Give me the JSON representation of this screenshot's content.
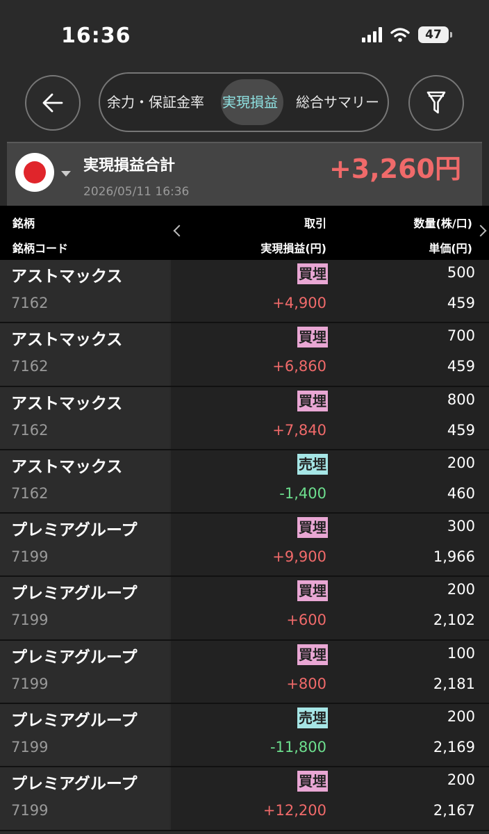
{
  "status_bar": {
    "time": "16:36",
    "battery": "47"
  },
  "tabs": [
    {
      "label": "余力・保証金率",
      "active": false
    },
    {
      "label": "実現損益",
      "active": true
    },
    {
      "label": "総合サマリー",
      "active": false
    }
  ],
  "summary": {
    "title": "実現損益合計",
    "value": "+3,260円",
    "datetime": "2026/05/11 16:36"
  },
  "columns": {
    "name": "銘柄",
    "code": "銘柄コード",
    "trade": "取引",
    "pnl": "実現損益(円)",
    "qty": "数量(株/口)",
    "price": "単価(円)"
  },
  "rows": [
    {
      "name": "アストマックス",
      "code": "7162",
      "trade": "買埋",
      "pnl": "+4,900",
      "qty": "500",
      "price": "459"
    },
    {
      "name": "アストマックス",
      "code": "7162",
      "trade": "買埋",
      "pnl": "+6,860",
      "qty": "700",
      "price": "459"
    },
    {
      "name": "アストマックス",
      "code": "7162",
      "trade": "買埋",
      "pnl": "+7,840",
      "qty": "800",
      "price": "459"
    },
    {
      "name": "アストマックス",
      "code": "7162",
      "trade": "売埋",
      "pnl": "-1,400",
      "qty": "200",
      "price": "460"
    },
    {
      "name": "プレミアグループ",
      "code": "7199",
      "trade": "買埋",
      "pnl": "+9,900",
      "qty": "300",
      "price": "1,966"
    },
    {
      "name": "プレミアグループ",
      "code": "7199",
      "trade": "買埋",
      "pnl": "+600",
      "qty": "200",
      "price": "2,102"
    },
    {
      "name": "プレミアグループ",
      "code": "7199",
      "trade": "買埋",
      "pnl": "+800",
      "qty": "100",
      "price": "2,181"
    },
    {
      "name": "プレミアグループ",
      "code": "7199",
      "trade": "売埋",
      "pnl": "-11,800",
      "qty": "200",
      "price": "2,169"
    },
    {
      "name": "プレミアグループ",
      "code": "7199",
      "trade": "買埋",
      "pnl": "+12,200",
      "qty": "200",
      "price": "2,167"
    }
  ],
  "colors": {
    "positive": "#f06a6a",
    "negative": "#6ddf8e",
    "buy_badge": "#e9a7d4",
    "sell_badge": "#a6e6e6",
    "active_tab": "#8fe1e1"
  },
  "icons": [
    "back-arrow-icon",
    "filter-icon",
    "wifi-icon",
    "signal-icon",
    "battery-icon",
    "japan-flag-icon",
    "chevron-left-icon",
    "chevron-right-icon"
  ]
}
